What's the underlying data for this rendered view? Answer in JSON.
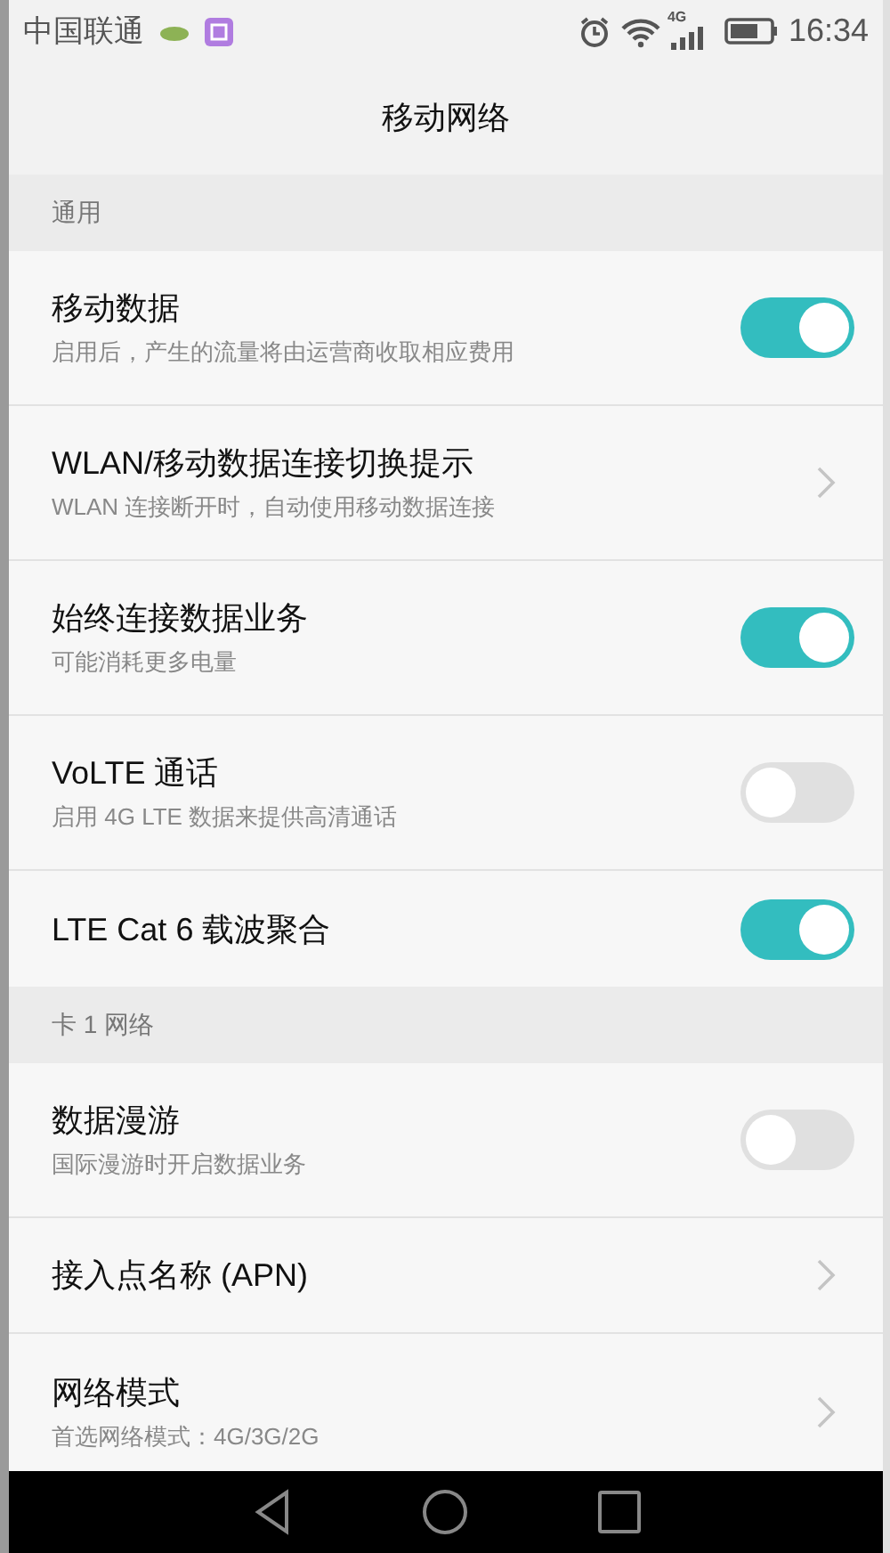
{
  "status_bar": {
    "carrier": "中国联通",
    "network": "4G",
    "time": "16:34"
  },
  "title": "移动网络",
  "sections": [
    {
      "header": "通用",
      "rows": [
        {
          "kind": "toggle",
          "title": "移动数据",
          "subtitle": "启用后，产生的流量将由运营商收取相应费用",
          "on": true
        },
        {
          "kind": "link",
          "title": "WLAN/移动数据连接切换提示",
          "subtitle": "WLAN 连接断开时，自动使用移动数据连接"
        },
        {
          "kind": "toggle",
          "title": "始终连接数据业务",
          "subtitle": "可能消耗更多电量",
          "on": true
        },
        {
          "kind": "toggle",
          "title": "VoLTE 通话",
          "subtitle": "启用 4G LTE 数据来提供高清通话",
          "on": false
        },
        {
          "kind": "toggle",
          "title": "LTE Cat 6 载波聚合",
          "on": true
        }
      ]
    },
    {
      "header": "卡 1 网络",
      "rows": [
        {
          "kind": "toggle",
          "title": "数据漫游",
          "subtitle": "国际漫游时开启数据业务",
          "on": false
        },
        {
          "kind": "link",
          "title": "接入点名称 (APN)"
        },
        {
          "kind": "link",
          "title": "网络模式",
          "subtitle": "首选网络模式：4G/3G/2G"
        }
      ]
    }
  ]
}
